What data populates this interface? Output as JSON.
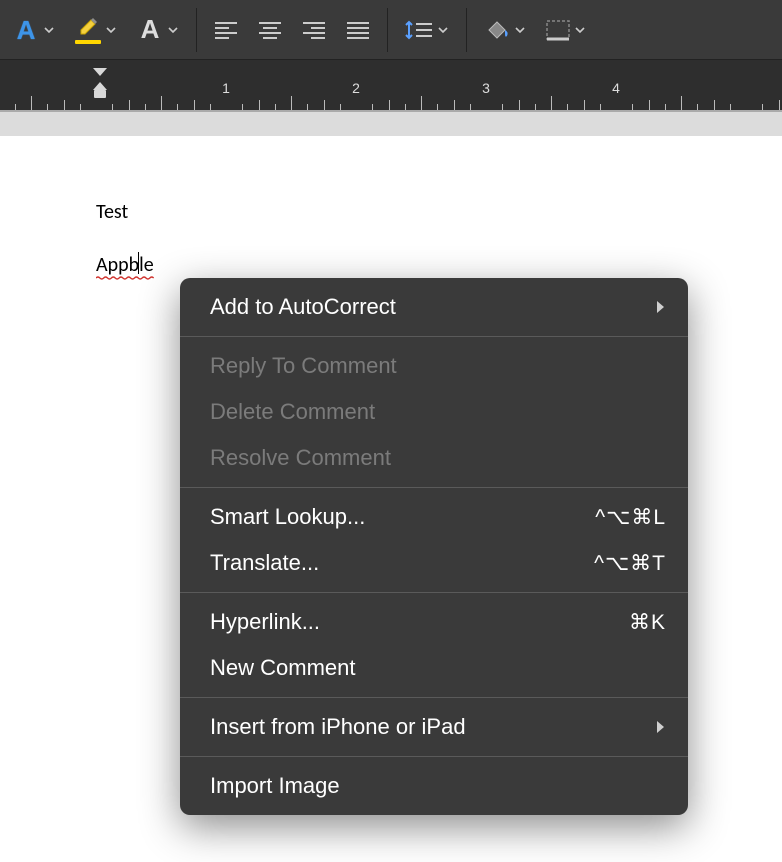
{
  "toolbar": {
    "font_letter_text_effects": "A",
    "font_letter_highlight": "A",
    "font_letter_color": "A",
    "colors": {
      "text_effects_outline": "#3d94e8",
      "highlight_bar": "#ffd600",
      "font_color_bar": "#e33b2e"
    }
  },
  "ruler": {
    "numbers": [
      1,
      2,
      3,
      4
    ]
  },
  "document": {
    "line1": "Test",
    "misspelled_before_caret": "Appb",
    "misspelled_after_caret": "le"
  },
  "context_menu": {
    "items": [
      {
        "label": "Add to AutoCorrect",
        "enabled": true,
        "submenu": true
      },
      {
        "div": true
      },
      {
        "label": "Reply To Comment",
        "enabled": false
      },
      {
        "label": "Delete Comment",
        "enabled": false
      },
      {
        "label": "Resolve Comment",
        "enabled": false
      },
      {
        "div": true
      },
      {
        "label": "Smart Lookup...",
        "enabled": true,
        "shortcut": "^⌥⌘L"
      },
      {
        "label": "Translate...",
        "enabled": true,
        "shortcut": "^⌥⌘T"
      },
      {
        "div": true
      },
      {
        "label": "Hyperlink...",
        "enabled": true,
        "shortcut": "⌘K"
      },
      {
        "label": "New Comment",
        "enabled": true
      },
      {
        "div": true
      },
      {
        "label": "Insert from iPhone or iPad",
        "enabled": true,
        "submenu": true
      },
      {
        "div": true
      },
      {
        "label": "Import Image",
        "enabled": true
      }
    ]
  }
}
